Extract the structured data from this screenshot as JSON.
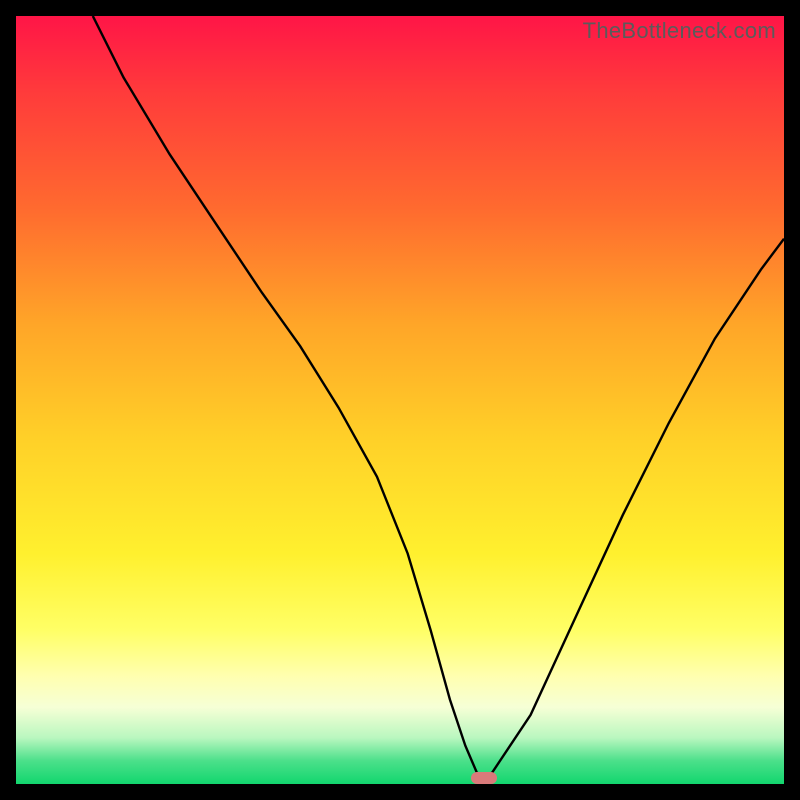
{
  "watermark": "TheBottleneck.com",
  "colors": {
    "frame": "#000000",
    "curve": "#000000",
    "marker": "#d97a7a",
    "gradient_top": "#ff1547",
    "gradient_bottom": "#12d66e"
  },
  "chart_data": {
    "type": "line",
    "title": "",
    "xlabel": "",
    "ylabel": "",
    "xlim": [
      0,
      100
    ],
    "ylim": [
      0,
      100
    ],
    "grid": false,
    "legend": false,
    "series": [
      {
        "name": "bottleneck-curve",
        "x": [
          10,
          14,
          20,
          26,
          32,
          37,
          42,
          47,
          51,
          54,
          56.5,
          58.5,
          60,
          61,
          62,
          67,
          73,
          79,
          85,
          91,
          97,
          100
        ],
        "y": [
          100,
          92,
          82,
          73,
          64,
          57,
          49,
          40,
          30,
          20,
          11,
          5,
          1.5,
          0.8,
          1.5,
          9,
          22,
          35,
          47,
          58,
          67,
          71
        ]
      }
    ],
    "marker": {
      "x": 61,
      "y": 0.8
    },
    "annotations": []
  }
}
